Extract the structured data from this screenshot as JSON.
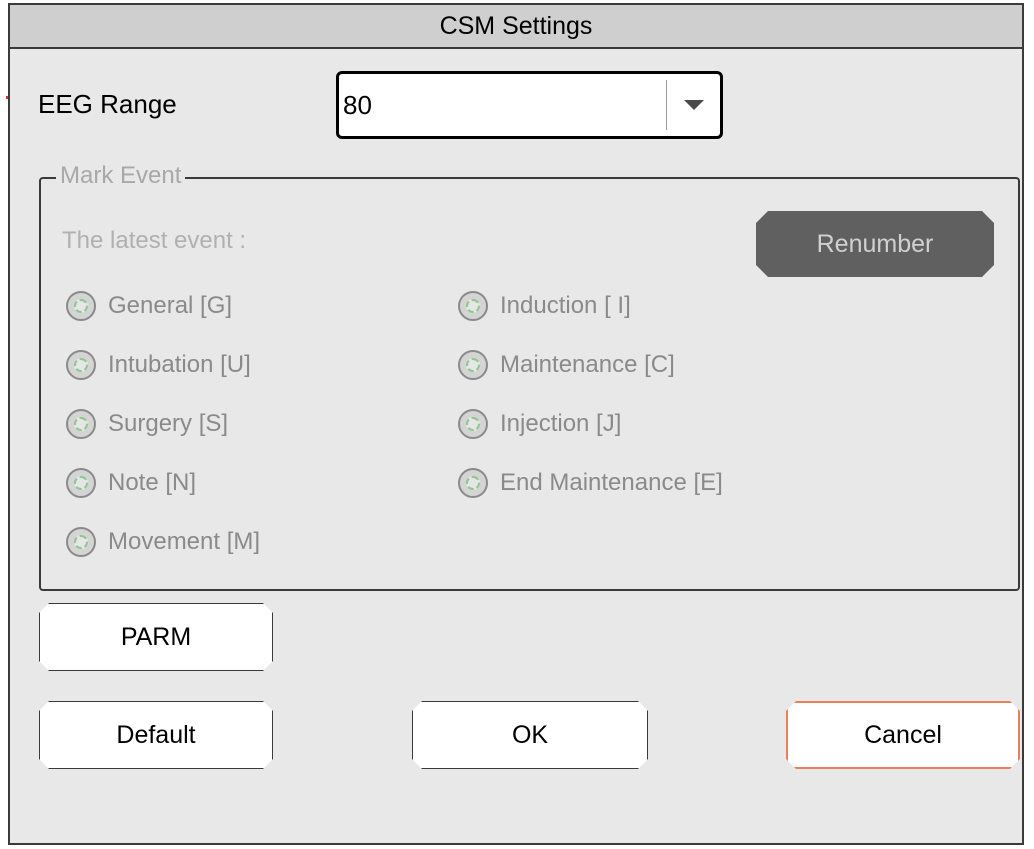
{
  "dialog": {
    "title": "CSM Settings"
  },
  "eeg_range": {
    "label": "EEG Range",
    "value": "80",
    "icon": "chevron-down-icon"
  },
  "mark_event": {
    "legend": "Mark Event",
    "latest_label": "The latest event :",
    "renumber_label": "Renumber",
    "options": [
      {
        "label": "General [G]"
      },
      {
        "label": "Intubation [U]"
      },
      {
        "label": "Surgery [S]"
      },
      {
        "label": "Note [N]"
      },
      {
        "label": "Movement [M]"
      },
      {
        "label": "Induction [ I]"
      },
      {
        "label": "Maintenance [C]"
      },
      {
        "label": "Injection [J]"
      },
      {
        "label": "End Maintenance [E]"
      }
    ]
  },
  "buttons": {
    "parm": "PARM",
    "default": "Default",
    "ok": "OK",
    "cancel": "Cancel"
  },
  "colors": {
    "dialog_bg": "#e8e8e8",
    "title_bg": "#cfcfcf",
    "renumber_bg": "#606060",
    "cancel_border": "#e8805a",
    "disabled_text": "#8a8a8a"
  }
}
